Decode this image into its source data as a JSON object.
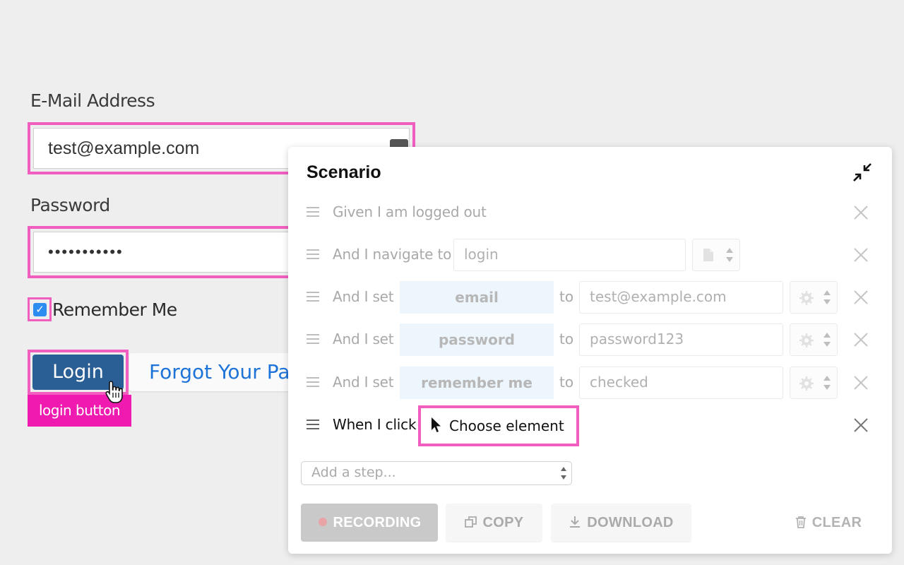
{
  "login_form": {
    "email_label": "E-Mail Address",
    "email_value": "test@example.com",
    "password_label": "Password",
    "password_value": "•••••••••••",
    "remember_label": "Remember Me",
    "remember_checked": true,
    "login_label": "Login",
    "login_tooltip": "login button",
    "forgot_label": "Forgot Your Password?"
  },
  "scenario": {
    "title": "Scenario",
    "steps": [
      {
        "prefix": "Given I am logged out"
      },
      {
        "prefix": "And I navigate to",
        "value": "login"
      },
      {
        "prefix": "And I set",
        "element": "email",
        "to": "to",
        "value": "test@example.com"
      },
      {
        "prefix": "And I set",
        "element": "password",
        "to": "to",
        "value": "password123"
      },
      {
        "prefix": "And I set",
        "element": "remember me",
        "to": "to",
        "value": "checked"
      },
      {
        "prefix": "When I click",
        "element": "Choose element"
      }
    ],
    "add_step_placeholder": "Add a step...",
    "buttons": {
      "recording": "RECORDING",
      "copy": "COPY",
      "download": "DOWNLOAD",
      "clear": "CLEAR"
    }
  },
  "colors": {
    "highlight": "#f25ec0",
    "tooltip": "#ef1bb0",
    "login_button": "#2a5f96",
    "element_pill": "#d6e8fb",
    "link": "#1e73d8"
  }
}
